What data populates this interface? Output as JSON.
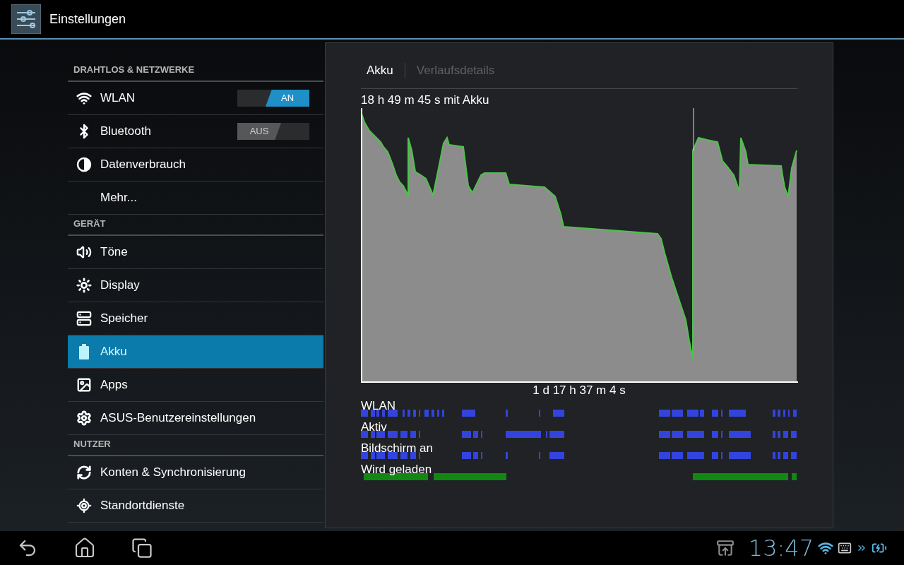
{
  "action_bar": {
    "title": "Einstellungen"
  },
  "sections": [
    {
      "header": "DRAHTLOS & NETZWERKE",
      "items": [
        {
          "label": "WLAN",
          "selected": false,
          "toggle": {
            "label": "AN",
            "on": true
          }
        },
        {
          "label": "Bluetooth",
          "selected": false,
          "toggle": {
            "label": "AUS",
            "on": false
          }
        },
        {
          "label": "Datenverbrauch",
          "selected": false
        },
        {
          "label": "Mehr...",
          "selected": false
        }
      ]
    },
    {
      "header": "GERÄT",
      "items": [
        {
          "label": "Töne",
          "selected": false
        },
        {
          "label": "Display",
          "selected": false
        },
        {
          "label": "Speicher",
          "selected": false
        },
        {
          "label": "Akku",
          "selected": true
        },
        {
          "label": "Apps",
          "selected": false
        },
        {
          "label": "ASUS-Benutzereinstellungen",
          "selected": false
        }
      ]
    },
    {
      "header": "NUTZER",
      "items": [
        {
          "label": "Konten & Synchronisierung",
          "selected": false
        },
        {
          "label": "Standortdienste",
          "selected": false
        }
      ]
    }
  ],
  "detail": {
    "tabs": [
      {
        "label": "Akku",
        "selected": true
      },
      {
        "label": "Verlaufsdetails",
        "selected": false
      }
    ],
    "chart_title": "18 h 49 m 45 s mit Akku",
    "duration": "1 d 17 h 37 m 4 s",
    "timelines": [
      {
        "label": "WLAN",
        "color": "#3344dd"
      },
      {
        "label": "Aktiv",
        "color": "#3344dd"
      },
      {
        "label": "Bildschirm an",
        "color": "#3344dd"
      },
      {
        "label": "Wird geladen",
        "color": "#118811"
      }
    ]
  },
  "status_bar": {
    "clock": "13:47"
  }
}
